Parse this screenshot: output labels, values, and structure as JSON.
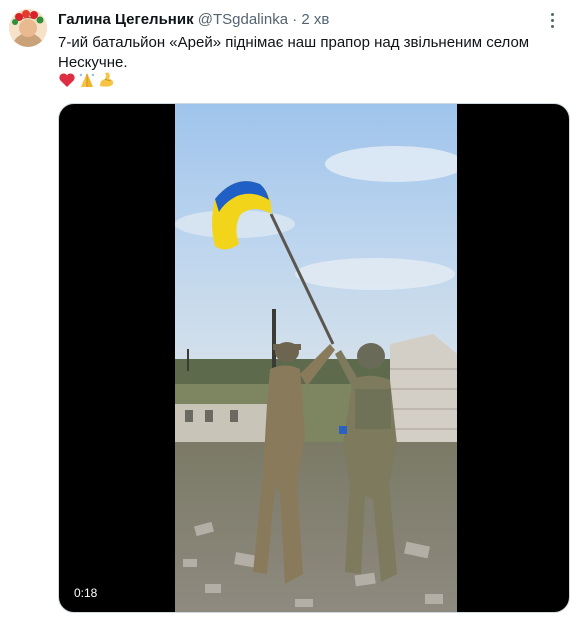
{
  "tweet": {
    "author_name": "Галина Цегельник",
    "handle": "@TSgdalinka",
    "separator": "·",
    "time": "2 хв",
    "text_line1": "7-ий батальйон «Арей» піднімає наш прапор над звільненим селом",
    "text_line2": "Нескучне.",
    "emojis": [
      "red-heart",
      "folded-hands",
      "flexed-biceps"
    ]
  },
  "media": {
    "video_duration": "0:18"
  },
  "colors": {
    "text_primary": "#0f1419",
    "text_secondary": "#536471",
    "flag_blue": "#1f5fc6",
    "flag_yellow": "#f2d51a"
  }
}
